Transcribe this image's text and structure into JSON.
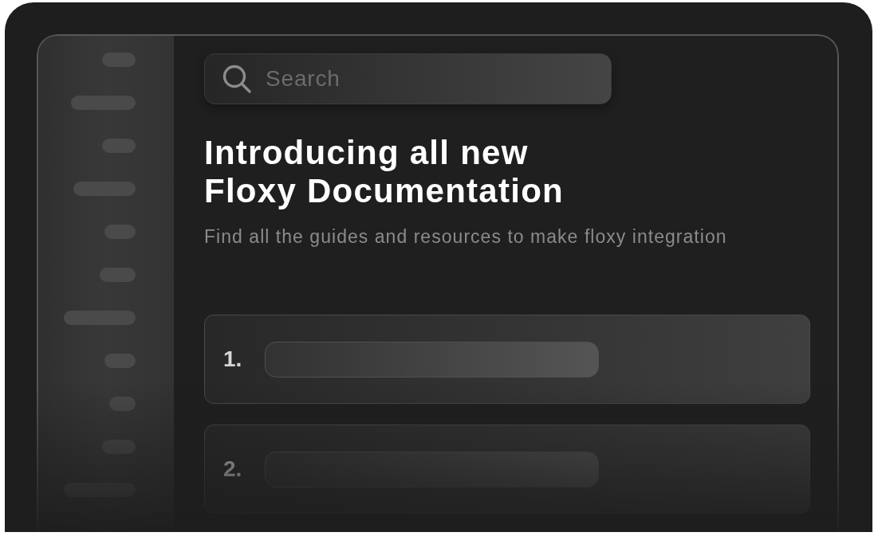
{
  "search": {
    "placeholder": "Search"
  },
  "headline": "Introducing all new\nFloxy Documentation",
  "subtitle": "Find all the guides and resources to make floxy integration",
  "steps": [
    {
      "number": "1."
    },
    {
      "number": "2."
    }
  ]
}
